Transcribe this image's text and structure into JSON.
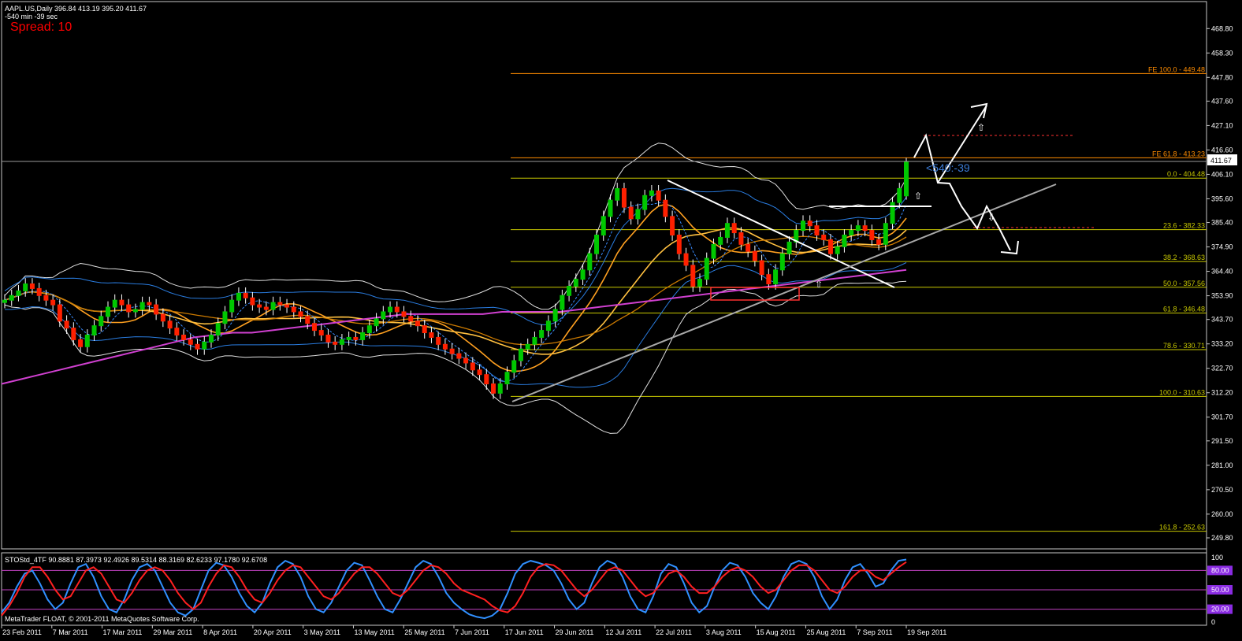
{
  "header": {
    "symbol_line": "AAPL.US,Daily  396.84 413.19 395.20 411.67",
    "timer_line": "-540 min -39 sec",
    "spread_text": "Spread: 10"
  },
  "countdown_text": "<540:-39",
  "footer_text": "MetaTrader FLOAT, © 2001-2011 MetaQuotes Software Corp.",
  "colors": {
    "bull": "#00c800",
    "bear": "#ff2000",
    "fib": "#c8c800",
    "fe": "#ff8c00",
    "pink_ma": "#d040d0",
    "orange_ma": "#ffa020",
    "sto_main": "#3090ff",
    "sto_signal": "#ff2020",
    "spread": "#ff0000",
    "countdown": "#3a7bd5"
  },
  "chart_data": [
    {
      "type": "candlestick",
      "title": "AAPL.US,Daily",
      "ylim": [
        249.8,
        476.0
      ],
      "ohlc_last": {
        "open": 396.84,
        "high": 413.19,
        "low": 395.2,
        "close": 411.67
      },
      "current_price_label": "411.67",
      "y_ticks": [
        "468.80",
        "458.30",
        "447.80",
        "437.60",
        "427.10",
        "416.60",
        "406.10",
        "395.60",
        "385.40",
        "374.90",
        "364.40",
        "353.90",
        "343.70",
        "333.20",
        "322.70",
        "312.20",
        "301.70",
        "291.50",
        "281.00",
        "270.50",
        "260.00",
        "249.80"
      ],
      "x_ticks": [
        "23 Feb 2011",
        "7 Mar 2011",
        "17 Mar 2011",
        "29 Mar 2011",
        "8 Apr 2011",
        "20 Apr 2011",
        "3 May 2011",
        "13 May 2011",
        "25 May 2011",
        "7 Jun 2011",
        "17 Jun 2011",
        "29 Jun 2011",
        "12 Jul 2011",
        "22 Jul 2011",
        "3 Aug 2011",
        "15 Aug 2011",
        "25 Aug 2011",
        "7 Sep 2011",
        "19 Sep 2011"
      ],
      "fibonacci_levels": [
        {
          "label": "FE 100.0 - 449.48",
          "value": 449.48,
          "kind": "fe"
        },
        {
          "label": "FE 61.8 - 413.23",
          "value": 413.23,
          "kind": "fe"
        },
        {
          "label": "0.0 - 404.48",
          "value": 404.48,
          "kind": "fib"
        },
        {
          "label": "23.6 - 382.33",
          "value": 382.33,
          "kind": "fib"
        },
        {
          "label": "38.2 - 368.63",
          "value": 368.63,
          "kind": "fib"
        },
        {
          "label": "50.0 - 357.56",
          "value": 357.56,
          "kind": "fib"
        },
        {
          "label": "61.8 - 346.48",
          "value": 346.48,
          "kind": "fib"
        },
        {
          "label": "78.6 - 330.71",
          "value": 330.71,
          "kind": "fib"
        },
        {
          "label": "100.0 - 310.63",
          "value": 310.63,
          "kind": "fib"
        },
        {
          "label": "161.8 - 252.63",
          "value": 252.63,
          "kind": "fib"
        }
      ],
      "close_series": [
        352,
        354,
        356,
        359,
        357,
        354,
        352,
        350,
        343,
        340,
        335,
        332,
        337,
        341,
        345,
        349,
        352,
        350,
        347,
        348,
        351,
        350,
        346,
        343,
        340,
        337,
        335,
        333,
        331,
        334,
        337,
        342,
        347,
        352,
        355,
        353,
        350,
        349,
        348,
        351,
        350,
        349,
        347,
        345,
        342,
        339,
        337,
        334,
        333,
        335,
        336,
        335,
        338,
        341,
        344,
        347,
        349,
        347,
        345,
        343,
        341,
        338,
        336,
        333,
        331,
        329,
        327,
        325,
        322,
        320,
        316,
        312,
        316,
        321,
        326,
        331,
        333,
        336,
        339,
        343,
        348,
        354,
        358,
        361,
        365,
        372,
        380,
        388,
        395,
        400,
        392,
        387,
        391,
        397,
        399,
        395,
        388,
        380,
        372,
        367,
        358,
        361,
        370,
        376,
        379,
        385,
        381,
        376,
        373,
        369,
        363,
        359,
        365,
        372,
        377,
        382,
        386,
        384,
        380,
        378,
        372,
        375,
        380,
        382,
        384,
        382,
        378,
        376,
        385,
        394,
        400,
        411.67
      ],
      "pink_ma_series": [
        316,
        318,
        320,
        322,
        324,
        326,
        328,
        330,
        332,
        334,
        336,
        337,
        338,
        338,
        339,
        340,
        341,
        342,
        343,
        344,
        345,
        346,
        346,
        346,
        346,
        346,
        347,
        347,
        347,
        347,
        348,
        349,
        350,
        351,
        352,
        353,
        354,
        355,
        356,
        357,
        358,
        359,
        360,
        361,
        362,
        363,
        364,
        365
      ]
    },
    {
      "type": "line",
      "title": "STOStd_4TF 90.8881 87.3973 92.4926 89.5314 88.3169 82.6233 97.1780 92.6708",
      "ylim": [
        0,
        100
      ],
      "y_ticks": [
        "100",
        "80.00",
        "50.00",
        "20.00",
        "0"
      ],
      "levels": [
        80,
        50,
        20
      ],
      "series": [
        {
          "values": [
            15,
            30,
            55,
            75,
            80,
            60,
            35,
            20,
            30,
            60,
            85,
            90,
            70,
            40,
            20,
            15,
            35,
            65,
            85,
            90,
            80,
            55,
            30,
            15,
            10,
            20,
            50,
            80,
            92,
            88,
            70,
            45,
            25,
            15,
            30,
            60,
            85,
            95,
            90,
            70,
            40,
            20,
            15,
            30,
            55,
            80,
            92,
            88,
            65,
            40,
            20,
            15,
            35,
            60,
            85,
            95,
            90,
            70,
            45,
            30,
            20,
            12,
            8,
            6,
            10,
            20,
            45,
            75,
            90,
            95,
            92,
            88,
            80,
            60,
            35,
            20,
            30,
            60,
            85,
            95,
            90,
            70,
            40,
            20,
            15,
            40,
            75,
            90,
            85,
            60,
            30,
            15,
            25,
            55,
            80,
            92,
            88,
            70,
            45,
            30,
            20,
            40,
            70,
            90,
            95,
            90,
            70,
            40,
            20,
            35,
            65,
            85,
            90,
            75,
            55,
            60,
            80,
            95,
            97
          ]
        },
        {
          "values": [
            10,
            25,
            45,
            70,
            85,
            85,
            70,
            50,
            35,
            40,
            60,
            80,
            85,
            75,
            55,
            35,
            30,
            45,
            65,
            80,
            85,
            80,
            65,
            45,
            30,
            20,
            30,
            55,
            75,
            88,
            85,
            70,
            50,
            35,
            30,
            45,
            65,
            80,
            88,
            85,
            70,
            55,
            40,
            35,
            45,
            60,
            75,
            85,
            85,
            75,
            60,
            45,
            40,
            50,
            65,
            80,
            88,
            85,
            75,
            60,
            50,
            45,
            40,
            35,
            25,
            18,
            15,
            25,
            45,
            70,
            85,
            90,
            88,
            80,
            65,
            50,
            40,
            50,
            65,
            80,
            85,
            80,
            65,
            50,
            40,
            45,
            60,
            75,
            80,
            70,
            55,
            45,
            45,
            55,
            70,
            80,
            85,
            80,
            70,
            55,
            45,
            50,
            65,
            80,
            88,
            88,
            80,
            65,
            50,
            45,
            55,
            70,
            80,
            80,
            70,
            65,
            75,
            85,
            93
          ]
        }
      ]
    }
  ]
}
